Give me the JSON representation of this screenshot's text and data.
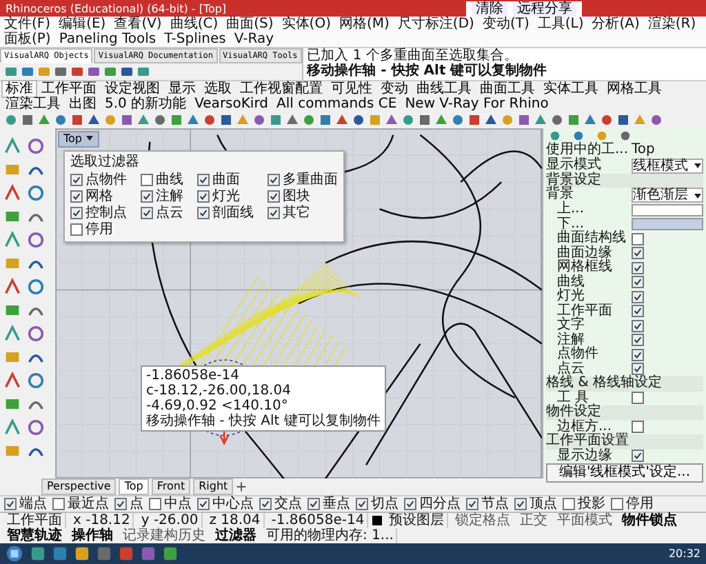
{
  "window": {
    "title": "Rhinoceros (Educational) (64-bit) - [Top]"
  },
  "menu": [
    "文件(F)",
    "编辑(E)",
    "查看(V)",
    "曲线(C)",
    "曲面(S)",
    "实体(O)",
    "网格(M)",
    "尺寸标注(D)",
    "变动(T)",
    "工具(L)",
    "分析(A)",
    "渲染(R)",
    "面板(P)",
    "Paneling Tools",
    "T-Splines",
    "V-Ray"
  ],
  "share_bar": {
    "buttons": [
      "清除",
      "远程分享"
    ]
  },
  "toolbar_tabs": [
    {
      "label": "VisualARQ Objects",
      "selected": true
    },
    {
      "label": "VisualARQ Documentation",
      "selected": false
    },
    {
      "label": "VisualARQ Tools",
      "selected": false
    }
  ],
  "command_history": "已加入 1 个多重曲面至选取集合。",
  "command_prompt": "移动操作轴 - 快按 Alt 键可以复制物件",
  "main_tabs": [
    {
      "label": "标准",
      "selected": true
    },
    {
      "label": "工作平面",
      "selected": false
    },
    {
      "label": "设定视图",
      "selected": false
    },
    {
      "label": "显示",
      "selected": false
    },
    {
      "label": "选取",
      "selected": false
    },
    {
      "label": "工作视窗配置",
      "selected": false
    },
    {
      "label": "可见性",
      "selected": false
    },
    {
      "label": "变动",
      "selected": false
    },
    {
      "label": "曲线工具",
      "selected": false
    },
    {
      "label": "曲面工具",
      "selected": false
    },
    {
      "label": "实体工具",
      "selected": false
    },
    {
      "label": "网格工具",
      "selected": false
    },
    {
      "label": "渲染工具",
      "selected": false
    },
    {
      "label": "出图",
      "selected": false
    },
    {
      "label": "5.0 的新功能",
      "selected": false
    },
    {
      "label": "VearsoKird",
      "selected": false
    },
    {
      "label": "All commands CE",
      "selected": false
    },
    {
      "label": "New V-Ray For Rhino",
      "selected": false
    }
  ],
  "viewport": {
    "label": "Top"
  },
  "selection_filter": {
    "title": "选取过滤器",
    "items": [
      {
        "label": "点物件",
        "checked": true
      },
      {
        "label": "曲线",
        "checked": false
      },
      {
        "label": "曲面",
        "checked": true
      },
      {
        "label": "多重曲面",
        "checked": true
      },
      {
        "label": "网格",
        "checked": true
      },
      {
        "label": "注解",
        "checked": true
      },
      {
        "label": "灯光",
        "checked": true
      },
      {
        "label": "图块",
        "checked": true
      },
      {
        "label": "控制点",
        "checked": true
      },
      {
        "label": "点云",
        "checked": true
      },
      {
        "label": "剖面线",
        "checked": true
      },
      {
        "label": "其它",
        "checked": true
      },
      {
        "label": "停用",
        "checked": false
      }
    ]
  },
  "tooltip": {
    "lines": [
      "-1.86058e-14",
      "c-18.12,-26.00,18.04",
      "-4.69,0.92  <140.10°",
      "移动操作轴 - 快按 Alt 键可以复制物件"
    ]
  },
  "properties": {
    "rows": [
      {
        "kind": "field",
        "label": "使用中的工...",
        "value": "Top"
      },
      {
        "kind": "select",
        "label": "显示模式",
        "value": "线框模式"
      },
      {
        "kind": "heading",
        "label": "背景设定"
      },
      {
        "kind": "select",
        "label": "背景",
        "value": "渐色渐层"
      },
      {
        "kind": "color",
        "label": "上...",
        "color": "#ffffff"
      },
      {
        "kind": "color",
        "label": "下...",
        "color": "#c4cfe6"
      },
      {
        "kind": "checkbox",
        "label": "曲面结构线",
        "checked": false
      },
      {
        "kind": "checkbox",
        "label": "曲面边缘",
        "checked": true
      },
      {
        "kind": "checkbox",
        "label": "网格框线",
        "checked": true
      },
      {
        "kind": "checkbox",
        "label": "曲线",
        "checked": true
      },
      {
        "kind": "checkbox",
        "label": "灯光",
        "checked": true
      },
      {
        "kind": "checkbox",
        "label": "工作平面",
        "checked": true
      },
      {
        "kind": "checkbox",
        "label": "文字",
        "checked": true
      },
      {
        "kind": "checkbox",
        "label": "注解",
        "checked": true
      },
      {
        "kind": "checkbox",
        "label": "点物件",
        "checked": true
      },
      {
        "kind": "checkbox",
        "label": "点云",
        "checked": true
      },
      {
        "kind": "heading",
        "label": "格线 & 格线轴设定"
      },
      {
        "kind": "checkbox",
        "label": "工 具",
        "checked": false
      },
      {
        "kind": "heading",
        "label": "物件设定"
      },
      {
        "kind": "checkbox",
        "label": "边框方...",
        "checked": false
      },
      {
        "kind": "heading",
        "label": "工作平面设置"
      },
      {
        "kind": "checkbox",
        "label": "显示边缘",
        "checked": true
      }
    ],
    "button": "编辑'线框模式'设定..."
  },
  "viewport_tabs": [
    {
      "label": "Perspective",
      "selected": false
    },
    {
      "label": "Top",
      "selected": true
    },
    {
      "label": "Front",
      "selected": false
    },
    {
      "label": "Right",
      "selected": false
    }
  ],
  "osnaps": [
    {
      "label": "端点",
      "checked": true
    },
    {
      "label": "最近点",
      "checked": false
    },
    {
      "label": "点",
      "checked": true
    },
    {
      "label": "中点",
      "checked": false
    },
    {
      "label": "中心点",
      "checked": true
    },
    {
      "label": "交点",
      "checked": true
    },
    {
      "label": "垂点",
      "checked": true
    },
    {
      "label": "切点",
      "checked": true
    },
    {
      "label": "四分点",
      "checked": true
    },
    {
      "label": "节点",
      "checked": true
    },
    {
      "label": "顶点",
      "checked": true
    },
    {
      "label": "投影",
      "checked": false
    },
    {
      "label": "停用",
      "checked": false
    }
  ],
  "status_bar": {
    "plane": "工作平面",
    "x": "x -18.12",
    "y": "y -26.00",
    "z": "z 18.04",
    "distance": "-1.86058e-14",
    "layer": "预设图层",
    "toggles": [
      {
        "label": "锁定格点",
        "on": false
      },
      {
        "label": "正交",
        "on": false
      },
      {
        "label": "平面模式",
        "on": false
      },
      {
        "label": "物件锁点",
        "on": true
      },
      {
        "label": "智慧轨迹",
        "on": true
      },
      {
        "label": "操作轴",
        "on": true
      },
      {
        "label": "记录建构历史",
        "on": false
      },
      {
        "label": "过滤器",
        "on": true
      }
    ],
    "memory": "可用的物理内存: 1..."
  },
  "taskbar": {
    "time": "20:32"
  }
}
